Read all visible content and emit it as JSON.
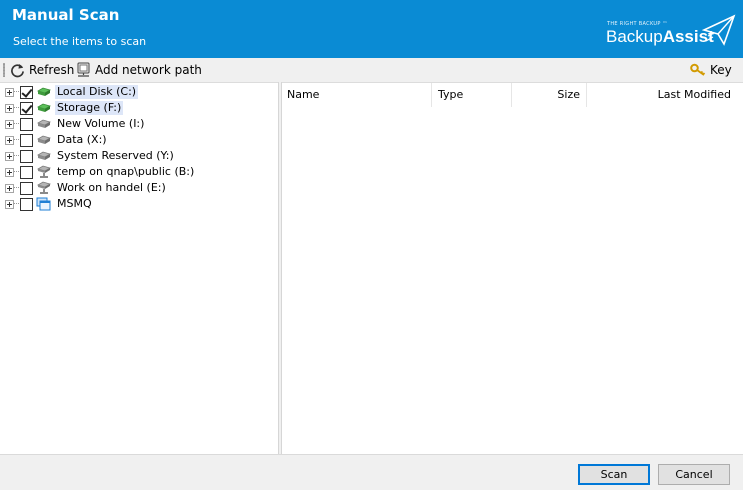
{
  "header": {
    "title": "Manual Scan",
    "subtitle": "Select the items to scan",
    "brand_tag": "THE RIGHT BACKUP ™",
    "brand_name_light": "Backup",
    "brand_name_bold": "Assist",
    "bg_color": "#0a8bd4"
  },
  "toolbar": {
    "refresh_label": "Refresh",
    "add_network_label": "Add network path",
    "key_label": "Key"
  },
  "tree": {
    "items": [
      {
        "label": "Local Disk (C:)",
        "checked": true,
        "icon": "drive-green-icon"
      },
      {
        "label": "Storage (F:)",
        "checked": true,
        "icon": "drive-green-icon"
      },
      {
        "label": "New Volume (I:)",
        "checked": false,
        "icon": "drive-gray-icon"
      },
      {
        "label": "Data (X:)",
        "checked": false,
        "icon": "drive-gray-icon"
      },
      {
        "label": "System Reserved (Y:)",
        "checked": false,
        "icon": "drive-gray-icon"
      },
      {
        "label": "temp on qnap\\public (B:)",
        "checked": false,
        "icon": "network-drive-icon"
      },
      {
        "label": "Work on handel (E:)",
        "checked": false,
        "icon": "network-drive-icon"
      },
      {
        "label": "MSMQ",
        "checked": false,
        "icon": "msmq-icon"
      }
    ]
  },
  "files": {
    "columns": [
      "Name",
      "Type",
      "Size",
      "Last Modified"
    ]
  },
  "footer": {
    "scan_label": "Scan",
    "cancel_label": "Cancel"
  }
}
